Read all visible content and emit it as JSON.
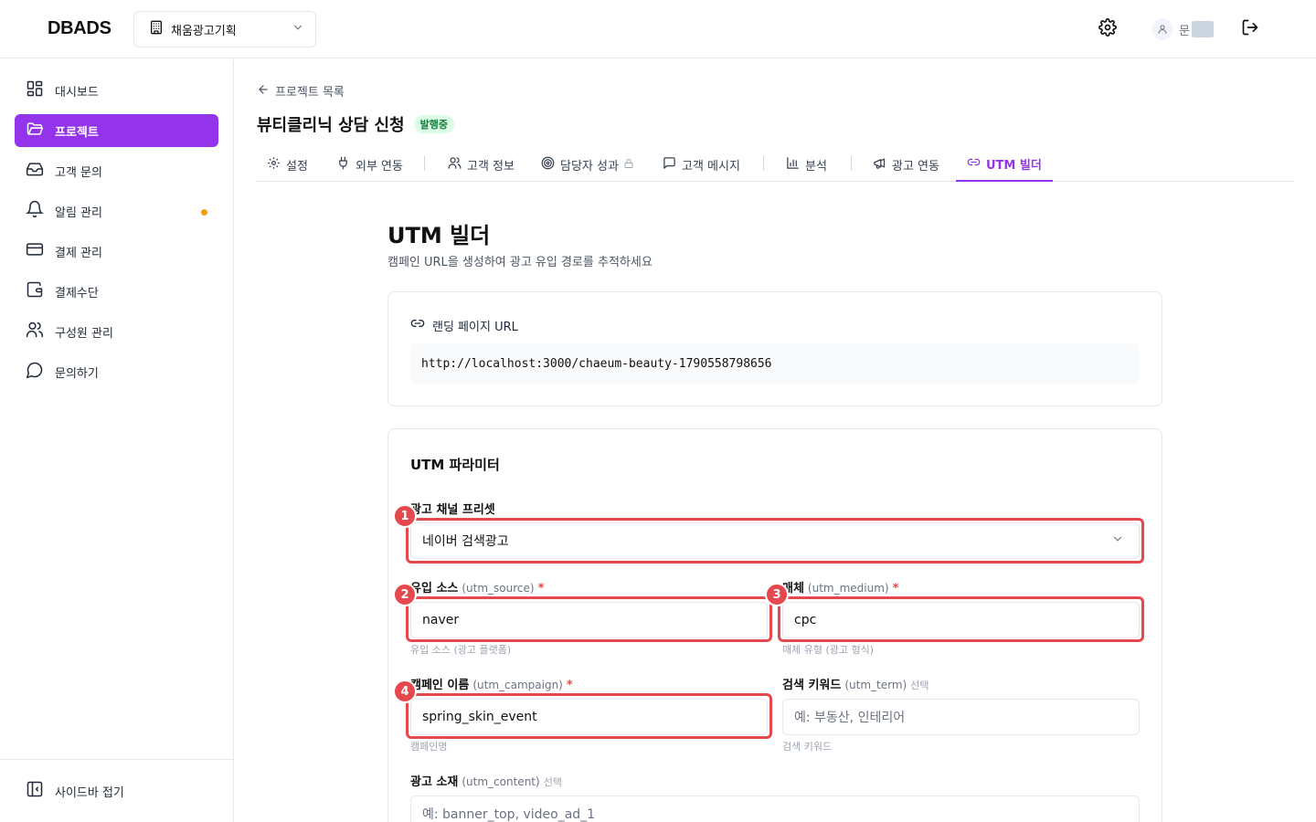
{
  "app": {
    "logo": "DBADS"
  },
  "header": {
    "org_name": "채움광고기획",
    "user_initial": "문"
  },
  "sidebar": {
    "items": [
      {
        "label": "대시보드"
      },
      {
        "label": "프로젝트"
      },
      {
        "label": "고객 문의"
      },
      {
        "label": "알림 관리"
      },
      {
        "label": "결제 관리"
      },
      {
        "label": "결제수단"
      },
      {
        "label": "구성원 관리"
      },
      {
        "label": "문의하기"
      }
    ],
    "collapse_label": "사이드바 접기"
  },
  "project": {
    "back_label": "프로젝트 목록",
    "title": "뷰티클리닉 상담 신청",
    "status": "발행중"
  },
  "tabs": [
    {
      "label": "설정"
    },
    {
      "label": "외부 연동"
    },
    {
      "label": "고객 정보"
    },
    {
      "label": "담당자 성과"
    },
    {
      "label": "고객 메시지"
    },
    {
      "label": "분석"
    },
    {
      "label": "광고 연동"
    },
    {
      "label": "UTM 빌더"
    }
  ],
  "utm": {
    "title": "UTM 빌더",
    "subtitle": "캠페인 URL을 생성하여 광고 유입 경로를 추적하세요",
    "landing_label": "랜딩 페이지 URL",
    "landing_url": "http://localhost:3000/chaeum-beauty-1790558798656",
    "params_title": "UTM 파라미터",
    "preset": {
      "label": "광고 채널 프리셋",
      "value": "네이버 검색광고"
    },
    "source": {
      "label": "유입 소스",
      "key": "(utm_source)",
      "required": "*",
      "value": "naver",
      "hint": "유입 소스 (광고 플랫폼)"
    },
    "medium": {
      "label": "매체",
      "key": "(utm_medium)",
      "required": "*",
      "value": "cpc",
      "hint": "매체 유형 (광고 형식)"
    },
    "campaign": {
      "label": "캠페인 이름",
      "key": "(utm_campaign)",
      "required": "*",
      "value": "spring_skin_event",
      "hint": "캠페인명"
    },
    "term": {
      "label": "검색 키워드",
      "key": "(utm_term)",
      "optional": "선택",
      "placeholder": "예: 부동산, 인테리어",
      "hint": "검색 키워드"
    },
    "content": {
      "label": "광고 소재",
      "key": "(utm_content)",
      "optional": "선택",
      "placeholder": "예: banner_top, video_ad_1"
    }
  },
  "markers": [
    "1",
    "2",
    "3",
    "4"
  ],
  "colors": {
    "accent": "#9333ea",
    "highlight": "#e5484d",
    "status_bg": "#dcfce7",
    "status_text": "#15803d",
    "alert_dot": "#f59e0b"
  }
}
